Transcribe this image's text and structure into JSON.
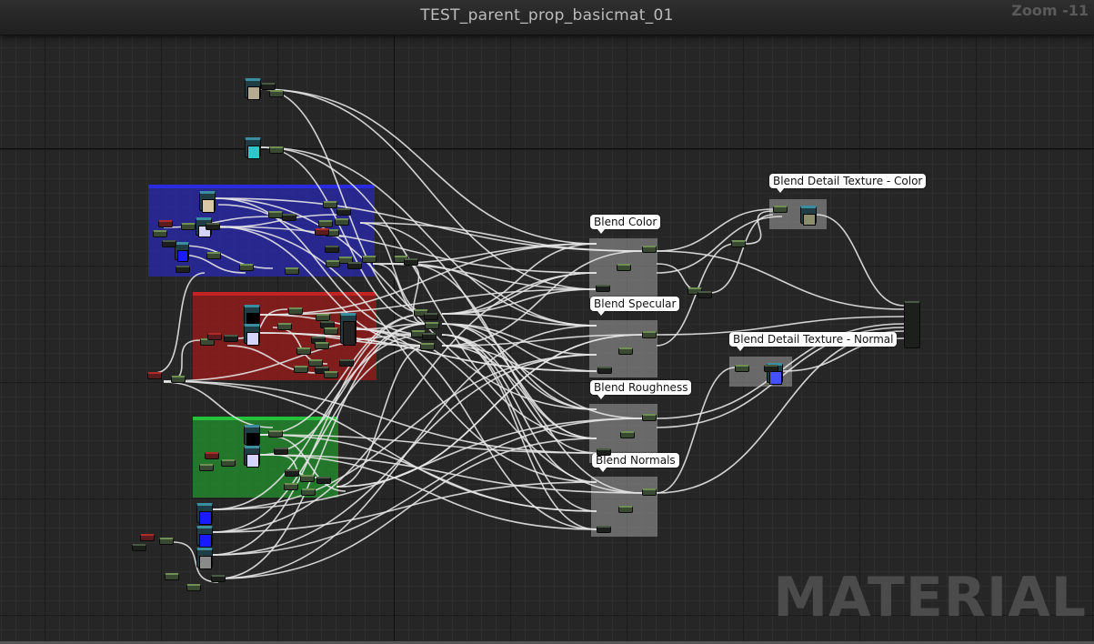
{
  "window": {
    "title": "TEST_parent_prop_basicmat_01",
    "zoom": "Zoom -11",
    "watermark": "MATERIAL"
  },
  "comments": [
    {
      "key": "blend_color",
      "label": "Blend Color"
    },
    {
      "key": "blend_specular",
      "label": "Blend Specular"
    },
    {
      "key": "blend_roughness",
      "label": "Blend Roughness"
    },
    {
      "key": "blend_normals",
      "label": "Blend Normals"
    },
    {
      "key": "blend_detail_color",
      "label": "Blend Detail Texture - Color"
    },
    {
      "key": "blend_detail_normal",
      "label": "Blend Detail Texture - Normal"
    }
  ],
  "colors": {
    "canvas": "#262626",
    "wire": "#e6e6e6",
    "comment_blue": "#2a2ae0",
    "comment_red": "#c42323",
    "comment_green": "#24c23a",
    "comment_grey": "#a0a0a0"
  },
  "icons": {
    "texture_samples": [
      "texture-sample-node-icon"
    ],
    "swatches": [
      "beige",
      "cyan",
      "lavender",
      "blue",
      "black",
      "grey",
      "normal-map-blue"
    ]
  }
}
